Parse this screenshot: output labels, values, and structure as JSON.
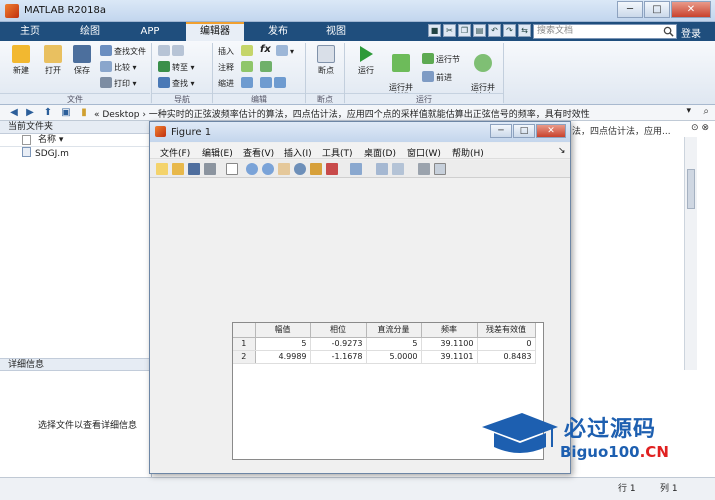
{
  "window": {
    "title": "MATLAB R2018a"
  },
  "tabs": [
    {
      "label": "主页"
    },
    {
      "label": "绘图"
    },
    {
      "label": "APP"
    },
    {
      "label": "编辑器"
    },
    {
      "label": "发布"
    },
    {
      "label": "视图"
    }
  ],
  "search": {
    "placeholder": "搜索文档"
  },
  "login_label": "登录",
  "ribbon": {
    "file": {
      "new": "新建",
      "open": "打开",
      "save": "保存",
      "find_files": "查找文件",
      "compare": "比较",
      "print": "打印",
      "group": "文件"
    },
    "nav": {
      "goto": "转至",
      "find": "查找",
      "group": "导航"
    },
    "edit": {
      "insert": "插入",
      "comment": "注释",
      "indent": "缩进",
      "fx": "fx",
      "group": "编辑"
    },
    "breakpoints": {
      "label": "断点",
      "group": "断点"
    },
    "run": {
      "run": "运行",
      "run_advance": "运行并\n前进",
      "run_section": "运行节",
      "advance": "前进",
      "run_time": "运行并\n计时",
      "group": "运行"
    }
  },
  "address": {
    "path": "« Desktop › 一种实时的正弦波频率估计的算法，四点估计法，应用四个点的采样值就能估算出正弦信号的频率，具有时效性",
    "bg_path": "法，四点估计法，应用..."
  },
  "left_panel": {
    "header": "当前文件夹",
    "col_name": "名称",
    "files": [
      {
        "name": "SDGJ.m"
      }
    ],
    "details_header": "详细信息",
    "details_text": "选择文件以查看详细信息"
  },
  "status": {
    "line_label": "行",
    "line_value": "1",
    "col_label": "列",
    "col_value": "1"
  },
  "figure": {
    "title": "Figure 1",
    "menus": [
      {
        "label": "文件(F)"
      },
      {
        "label": "编辑(E)"
      },
      {
        "label": "查看(V)"
      },
      {
        "label": "插入(I)"
      },
      {
        "label": "工具(T)"
      },
      {
        "label": "桌面(D)"
      },
      {
        "label": "窗口(W)"
      },
      {
        "label": "帮助(H)"
      }
    ],
    "table": {
      "columns": [
        "幅值",
        "相位",
        "直流分量",
        "频率",
        "残差有效值"
      ],
      "rows": [
        {
          "id": "1",
          "cells": [
            "5",
            "-0.9273",
            "5",
            "39.1100",
            "0"
          ]
        },
        {
          "id": "2",
          "cells": [
            "4.9989",
            "-1.1678",
            "5.0000",
            "39.1101",
            "0.8483"
          ]
        }
      ]
    }
  },
  "watermark": {
    "title": "必过源码",
    "sub_main": "Biguo100",
    "sub_cn": ".CN"
  },
  "colors": {
    "accent": "#f0a030",
    "tabbar": "#1f4e7d",
    "watermark_blue": "#1d5fb0",
    "watermark_red": "#e02020"
  }
}
